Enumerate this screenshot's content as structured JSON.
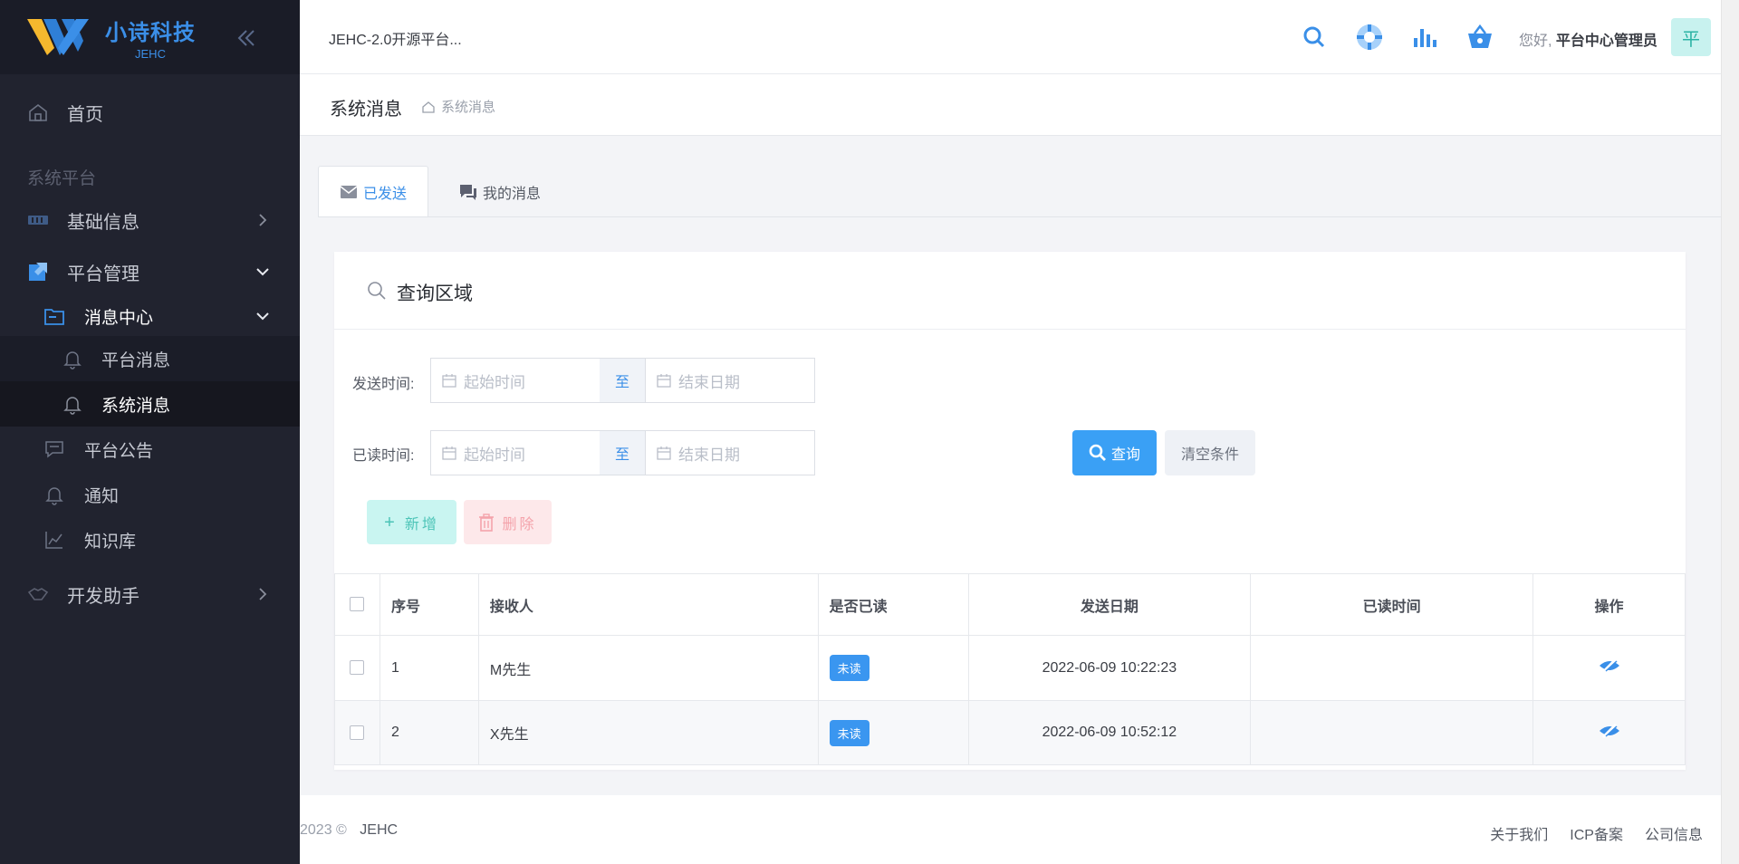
{
  "brand": {
    "name": "小诗科技",
    "sub": "JEHC"
  },
  "sidebar": {
    "home": "首页",
    "section": "系统平台",
    "items": [
      {
        "label": "基础信息"
      },
      {
        "label": "平台管理"
      },
      {
        "label": "消息中心"
      },
      {
        "label": "平台消息"
      },
      {
        "label": "系统消息"
      },
      {
        "label": "平台公告"
      },
      {
        "label": "通知"
      },
      {
        "label": "知识库"
      },
      {
        "label": "开发助手"
      }
    ]
  },
  "topbar": {
    "title": "JEHC-2.0开源平台...",
    "greeting": "您好,",
    "user": "平台中心管理员",
    "avatar": "平"
  },
  "page": {
    "title": "系统消息",
    "crumb": "系统消息"
  },
  "tabs": [
    {
      "label": "已发送"
    },
    {
      "label": "我的消息"
    }
  ],
  "query": {
    "title": "查询区域",
    "send_label": "发送时间:",
    "read_label": "已读时间:",
    "start_placeholder": "起始时间",
    "end_placeholder": "结束日期",
    "to": "至",
    "search": "查询",
    "clear": "清空条件"
  },
  "actions": {
    "add": "新增",
    "del": "删除"
  },
  "table": {
    "headers": [
      "序号",
      "接收人",
      "是否已读",
      "发送日期",
      "已读时间",
      "操作"
    ],
    "rows": [
      {
        "no": "1",
        "receiver": "M先生",
        "status": "未读",
        "send_date": "2022-06-09 10:22:23",
        "read_time": ""
      },
      {
        "no": "2",
        "receiver": "X先生",
        "status": "未读",
        "send_date": "2022-06-09 10:52:12",
        "read_time": ""
      }
    ]
  },
  "footer": {
    "year": "2023 ©",
    "company": "JEHC",
    "links": [
      "关于我们",
      "ICP备案",
      "公司信息"
    ]
  }
}
